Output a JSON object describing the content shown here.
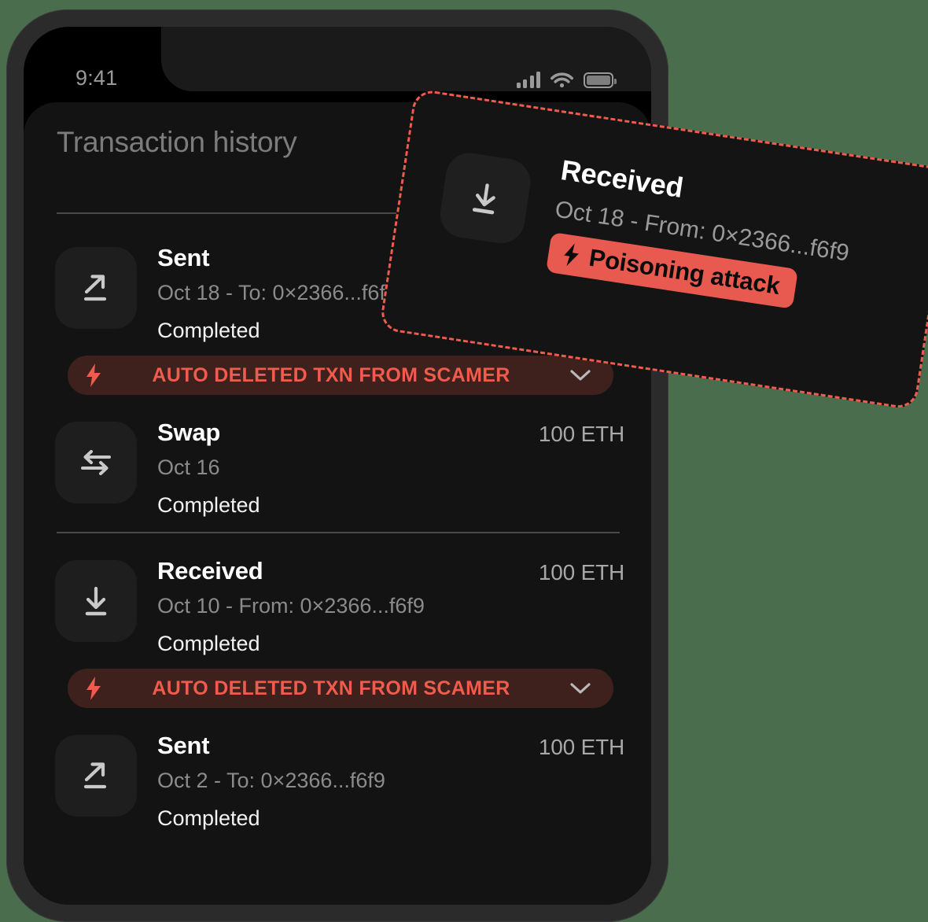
{
  "status_bar": {
    "time": "9:41",
    "signal_icon": "cellular-signal-icon",
    "wifi_icon": "wifi-icon",
    "battery_icon": "battery-icon"
  },
  "header": {
    "title": "Transaction history"
  },
  "colors": {
    "alert_red": "#ef5b4c",
    "alert_bg": "#3e211d",
    "badge_red": "#e8594f",
    "dashed_border": "#ef5b4c",
    "screen_bg": "#131313",
    "icon_tile": "#1e1e1e"
  },
  "transactions": [
    {
      "icon": "arrow-up-right-icon",
      "title": "Sent",
      "subtitle": "Oct 18 - To: 0×2366...f6f9",
      "status": "Completed",
      "amount": ""
    },
    {
      "icon": "swap-arrows-icon",
      "title": "Swap",
      "subtitle": "Oct 16",
      "status": "Completed",
      "amount": "100 ETH"
    },
    {
      "icon": "arrow-down-line-icon",
      "title": "Received",
      "subtitle": "Oct 10 - From: 0×2366...f6f9",
      "status": "Completed",
      "amount": "100 ETH"
    },
    {
      "icon": "arrow-up-right-icon",
      "title": "Sent",
      "subtitle": "Oct 2 - To: 0×2366...f6f9",
      "status": "Completed",
      "amount": "100 ETH"
    }
  ],
  "alerts": {
    "label": "AUTO DELETED TXN FROM SCAMER",
    "bolt_icon": "lightning-bolt-icon",
    "expand_icon": "chevron-down-icon"
  },
  "callout": {
    "icon": "arrow-down-line-icon",
    "title": "Received",
    "subtitle": "Oct 18 - From: 0×2366...f6f9",
    "badge_label": "Poisoning attack",
    "badge_icon": "lightning-bolt-icon"
  }
}
